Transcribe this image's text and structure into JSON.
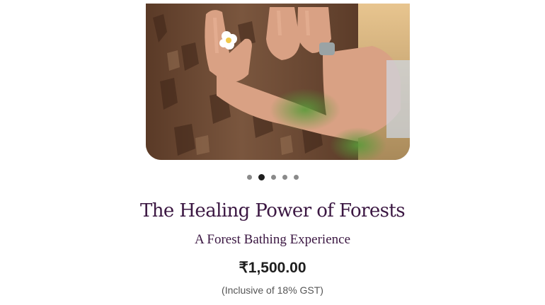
{
  "carousel": {
    "image_alt": "Hands touching tree bark",
    "slide_count": 5,
    "active_slide": 2
  },
  "product": {
    "title": "The Healing Power of Forests",
    "subtitle": "A Forest Bathing Experience",
    "price": "₹1,500.00",
    "tax_note": "(Inclusive of 18% GST)"
  },
  "colors": {
    "title": "#3b1742",
    "price": "#1e1e1e",
    "dot_active": "#1f1f1f",
    "dot_inactive": "#8a8a8a"
  }
}
